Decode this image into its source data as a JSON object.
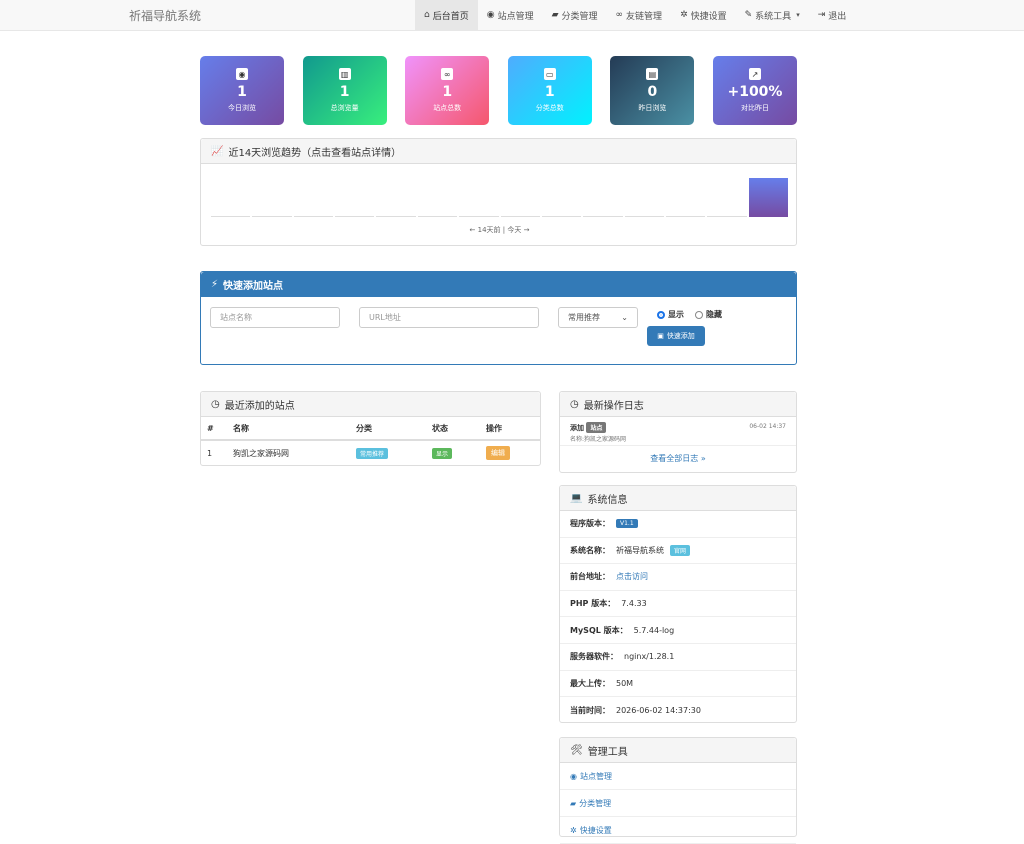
{
  "brand": "祈福导航系统",
  "nav": [
    {
      "icon": "home-icon",
      "glyph": "⌂",
      "label": "后台首页",
      "active": true
    },
    {
      "icon": "globe-icon",
      "glyph": "◉",
      "label": "站点管理"
    },
    {
      "icon": "folder-open-icon",
      "glyph": "▰",
      "label": "分类管理"
    },
    {
      "icon": "link-icon",
      "glyph": "∞",
      "label": "友链管理"
    },
    {
      "icon": "gear-icon",
      "glyph": "✲",
      "label": "快捷设置"
    },
    {
      "icon": "wrench-icon",
      "glyph": "✎",
      "label": "系统工具"
    },
    {
      "icon": "logout-icon",
      "glyph": "⇥",
      "label": "退出"
    }
  ],
  "stats": [
    {
      "icon": "eye-icon",
      "glyph": "◉",
      "value": "1",
      "label": "今日浏览"
    },
    {
      "icon": "bar-chart-icon",
      "glyph": "▥",
      "value": "1",
      "label": "总浏览量"
    },
    {
      "icon": "link-icon",
      "glyph": "∞",
      "value": "1",
      "label": "站点总数"
    },
    {
      "icon": "folder-icon",
      "glyph": "▭",
      "value": "1",
      "label": "分类总数"
    },
    {
      "icon": "calendar-icon",
      "glyph": "▤",
      "value": "0",
      "label": "昨日浏览"
    },
    {
      "icon": "trend-icon",
      "glyph": "↗",
      "value": "+100%",
      "label": "对比昨日"
    }
  ],
  "trend": {
    "title": "近14天浏览趋势（点击查看站点详情）",
    "caption": "← 14天前 | 今天 →"
  },
  "chart_data": {
    "type": "bar",
    "values": [
      0,
      0,
      0,
      0,
      0,
      0,
      0,
      0,
      0,
      0,
      0,
      0,
      0,
      1
    ]
  },
  "quick_add": {
    "title": "快速添加站点",
    "name_placeholder": "站点名称",
    "url_placeholder": "URL地址",
    "category_selected": "常用推荐",
    "radio_show": "显示",
    "radio_hide": "隐藏",
    "submit": "快速添加"
  },
  "recent": {
    "title": "最近添加的站点",
    "headers": [
      "#",
      "名称",
      "分类",
      "状态",
      "操作"
    ],
    "rows": [
      {
        "num": "1",
        "name": "狗凯之家源码网",
        "category": "常用推荐",
        "status": "显示",
        "action": "编辑"
      }
    ]
  },
  "logs": {
    "title": "最新操作日志",
    "items": [
      {
        "action": "添加",
        "tag": "站点",
        "detail": "名称:狗凯之家源码网",
        "time": "06-02 14:37"
      }
    ],
    "more": "查看全部日志 »"
  },
  "sysinfo": {
    "title": "系统信息",
    "version_label": "程序版本：",
    "version": "V1.1",
    "name_label": "系统名称：",
    "name": "祈福导航系统",
    "name_tag": "官网",
    "front_label": "前台地址：",
    "front": "点击访问",
    "php_label": "PHP 版本：",
    "php": "7.4.33",
    "mysql_label": "MySQL 版本：",
    "mysql": "5.7.44-log",
    "server_label": "服务器软件：",
    "server": "nginx/1.28.1",
    "upload_label": "最大上传：",
    "upload": "50M",
    "time_label": "当前时间：",
    "time": "2026-06-02 14:37:30"
  },
  "tools": {
    "title": "管理工具",
    "items": [
      "站点管理",
      "分类管理",
      "快捷设置"
    ]
  }
}
